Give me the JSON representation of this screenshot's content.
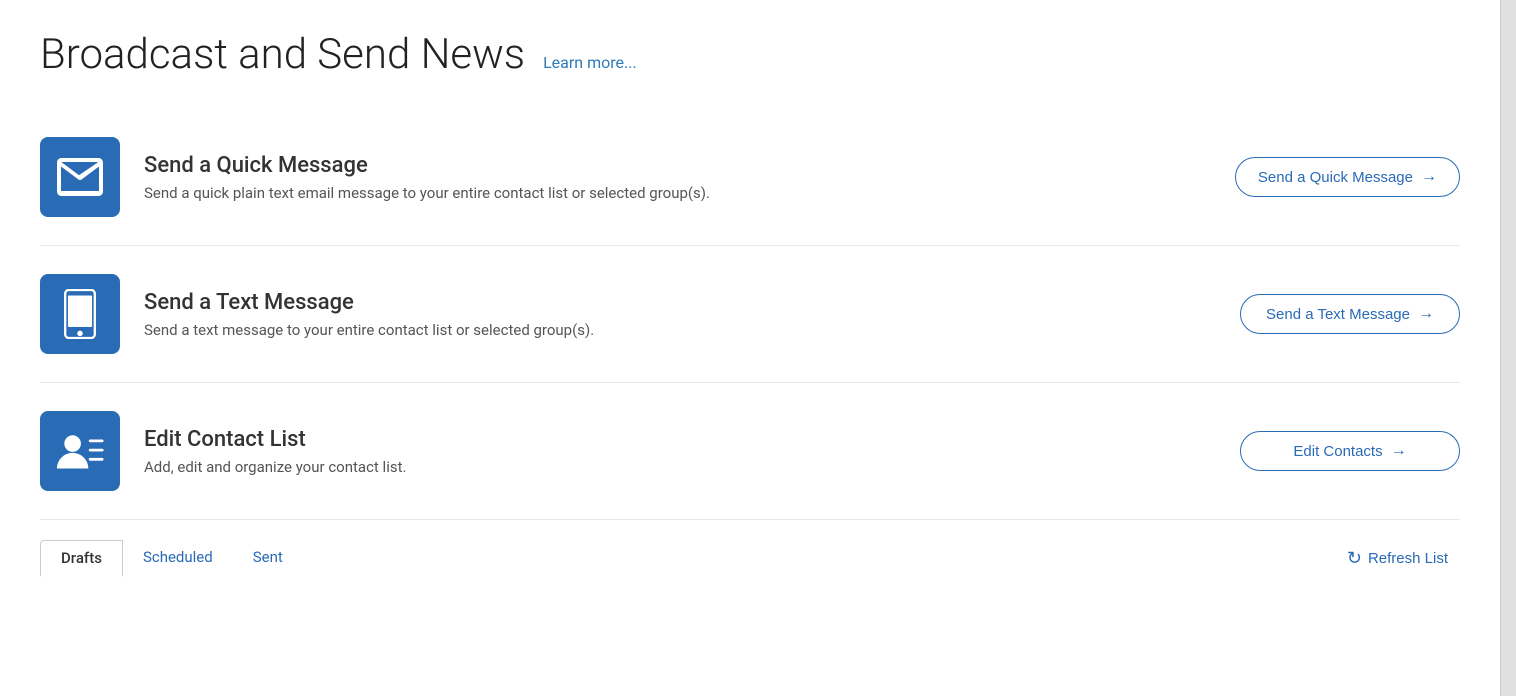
{
  "page": {
    "title": "Broadcast and Send News",
    "learn_more_label": "Learn more...",
    "sections": [
      {
        "id": "quick-message",
        "icon": "envelope",
        "heading": "Send a Quick Message",
        "description": "Send a quick plain text email message to your entire contact list or selected group(s).",
        "button_label": "Send a Quick Message",
        "button_arrow": "→"
      },
      {
        "id": "text-message",
        "icon": "mobile",
        "heading": "Send a Text Message",
        "description": "Send a text message to your entire contact list or selected group(s).",
        "button_label": "Send a Text Message",
        "button_arrow": "→"
      },
      {
        "id": "contact-list",
        "icon": "contacts",
        "heading": "Edit Contact List",
        "description": "Add, edit and organize your contact list.",
        "button_label": "Edit Contacts",
        "button_arrow": "→"
      }
    ],
    "tabs": [
      {
        "label": "Drafts",
        "active": true
      },
      {
        "label": "Scheduled",
        "active": false
      },
      {
        "label": "Sent",
        "active": false
      }
    ],
    "refresh_button_label": "Refresh List"
  }
}
